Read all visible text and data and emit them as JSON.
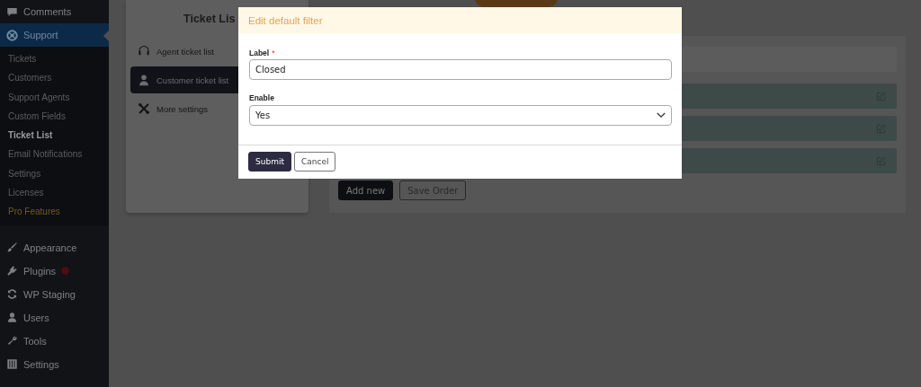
{
  "sidebar": {
    "items": [
      {
        "label": "Comments",
        "kind": "comment",
        "selected": false
      },
      {
        "label": "Support",
        "kind": "support",
        "selected": true,
        "children": [
          {
            "label": "Tickets",
            "selected": false
          },
          {
            "label": "Customers",
            "selected": false
          },
          {
            "label": "Support Agents",
            "selected": false
          },
          {
            "label": "Custom Fields",
            "selected": false
          },
          {
            "label": "Ticket List",
            "selected": true
          },
          {
            "label": "Email Notifications",
            "selected": false
          },
          {
            "label": "Settings",
            "selected": false
          },
          {
            "label": "Licenses",
            "selected": false
          },
          {
            "label": "Pro Features",
            "selected": false,
            "color": "#6e5f14"
          }
        ]
      },
      {
        "label": "Appearance",
        "kind": "brush",
        "selected": false
      },
      {
        "label": "Plugins",
        "kind": "plug",
        "selected": false,
        "badge": true
      },
      {
        "label": "WP Staging",
        "kind": "sync",
        "selected": false
      },
      {
        "label": "Users",
        "kind": "user",
        "selected": false
      },
      {
        "label": "Tools",
        "kind": "wrench",
        "selected": false
      },
      {
        "label": "Settings",
        "kind": "grid",
        "selected": false
      }
    ]
  },
  "settings_card": {
    "title": "Ticket Lis",
    "menu": [
      {
        "label": "Agent ticket list",
        "kind": "headset",
        "selected": false
      },
      {
        "label": "Customer ticket list",
        "kind": "person",
        "selected": true
      },
      {
        "label": "More settings",
        "kind": "tools",
        "selected": false
      }
    ]
  },
  "filters_card": {
    "rows": [
      {
        "kind": "filter"
      },
      {
        "kind": "filter"
      },
      {
        "kind": "filter"
      }
    ],
    "buttons": [
      {
        "label": "Add new",
        "kind": "primary"
      },
      {
        "label": "Save Order",
        "kind": "outline"
      }
    ]
  },
  "modal": {
    "title": "Edit default filter",
    "fields": [
      {
        "label": "Label",
        "required_mark": "*",
        "kind": "text",
        "value": "Closed"
      },
      {
        "label": "Enable",
        "kind": "select",
        "value": "Yes"
      }
    ],
    "buttons": [
      {
        "label": "Submit",
        "kind": "primary"
      },
      {
        "label": "Cancel",
        "kind": "secondary"
      }
    ]
  }
}
